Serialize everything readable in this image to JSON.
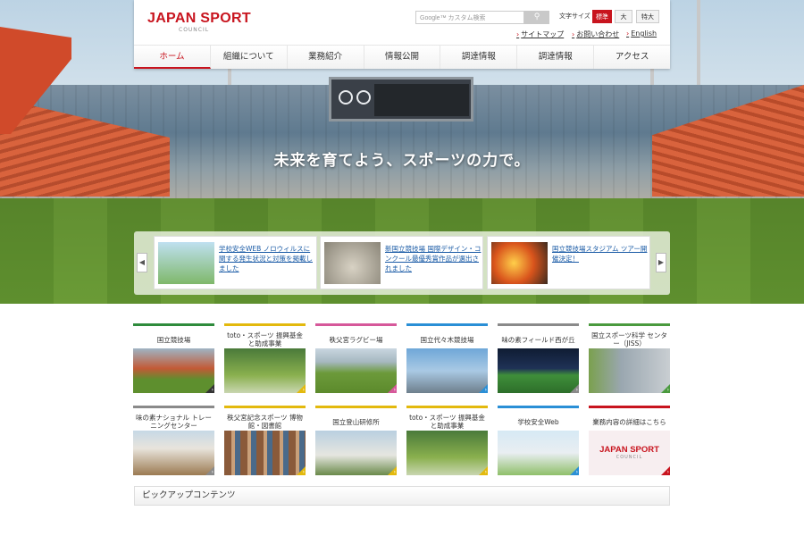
{
  "header": {
    "logo_main": "JAPAN SPORT",
    "logo_sub": "COUNCIL",
    "search_placeholder": "Google™ カスタム検索",
    "search_button_icon": "search-icon",
    "font_size_label": "文字サイズ",
    "font_sizes": [
      "標準",
      "大",
      "特大"
    ],
    "util_links": [
      "サイトマップ",
      "お問い合わせ",
      "English"
    ]
  },
  "nav": {
    "items": [
      "ホーム",
      "組織について",
      "業務紹介",
      "情報公開",
      "調達情報",
      "調達情報",
      "アクセス"
    ]
  },
  "hero": {
    "tagline": "未来を育てよう、スポーツの力で。"
  },
  "carousel": {
    "prev_icon": "chevron-left-icon",
    "next_icon": "chevron-right-icon",
    "slides": [
      {
        "text": "学校安全WEB ノロウィルスに関する発生状況と対策を掲載しました"
      },
      {
        "text": "新国立競技場 国際デザイン・コンクール最優秀賞作品が選出されました"
      },
      {
        "text": "国立競技場スタジアム ツアー開催決定！"
      }
    ]
  },
  "cards": [
    {
      "label": "国立競技場",
      "color": "#2e8b3c"
    },
    {
      "label": "toto・スポーツ 振興基金と助成事業",
      "color": "#e3b90d"
    },
    {
      "label": "秩父宮ラグビー場",
      "color": "#d6589a"
    },
    {
      "label": "国立代々木競技場",
      "color": "#2a8fd6"
    },
    {
      "label": "味の素フィールド西が丘",
      "color": "#8a8a8a"
    },
    {
      "label": "国立スポーツ科学 センター（JISS）",
      "color": "#4a9a3e"
    },
    {
      "label": "味の素ナショナル トレーニングセンター",
      "color": "#8a8a8a"
    },
    {
      "label": "秩父宮記念スポーツ 博物館・図書館",
      "color": "#e3b90d"
    },
    {
      "label": "国立登山研修所",
      "color": "#e3b90d"
    },
    {
      "label": "toto・スポーツ 振興基金と助成事業",
      "color": "#e3b90d"
    },
    {
      "label": "学校安全Web",
      "color": "#2a8fd6"
    },
    {
      "label": "業務内容の詳細はこちら",
      "color": "#c8141e"
    }
  ],
  "card_logo": {
    "main": "JAPAN SPORT",
    "sub": "COUNCIL"
  },
  "pickup": {
    "title": "ピックアップコンテンツ"
  }
}
